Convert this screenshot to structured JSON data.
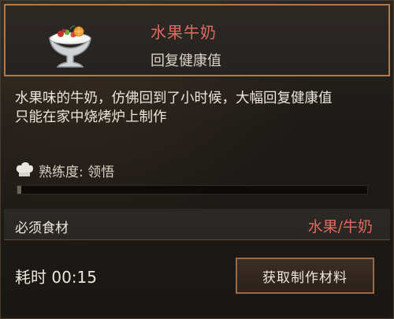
{
  "item": {
    "name": "水果牛奶",
    "effect": "回复健康值",
    "icon": "fruit-milk-sundae-icon"
  },
  "description": {
    "line1": "水果味的牛奶，仿佛回到了小时候，大幅回复健康值",
    "line2": "只能在家中烧烤炉上制作"
  },
  "proficiency": {
    "label": "熟练度: 领悟",
    "icon": "chef-hat-icon",
    "progress_fraction": 0.012
  },
  "ingredients": {
    "label": "必须食材",
    "value": "水果/牛奶"
  },
  "craft_time": {
    "label": "耗时 00:15"
  },
  "actions": {
    "get_materials_label": "获取制作材料"
  },
  "colors": {
    "accent_red": "#e06a5c",
    "frame_gold": "#b07a4a"
  }
}
